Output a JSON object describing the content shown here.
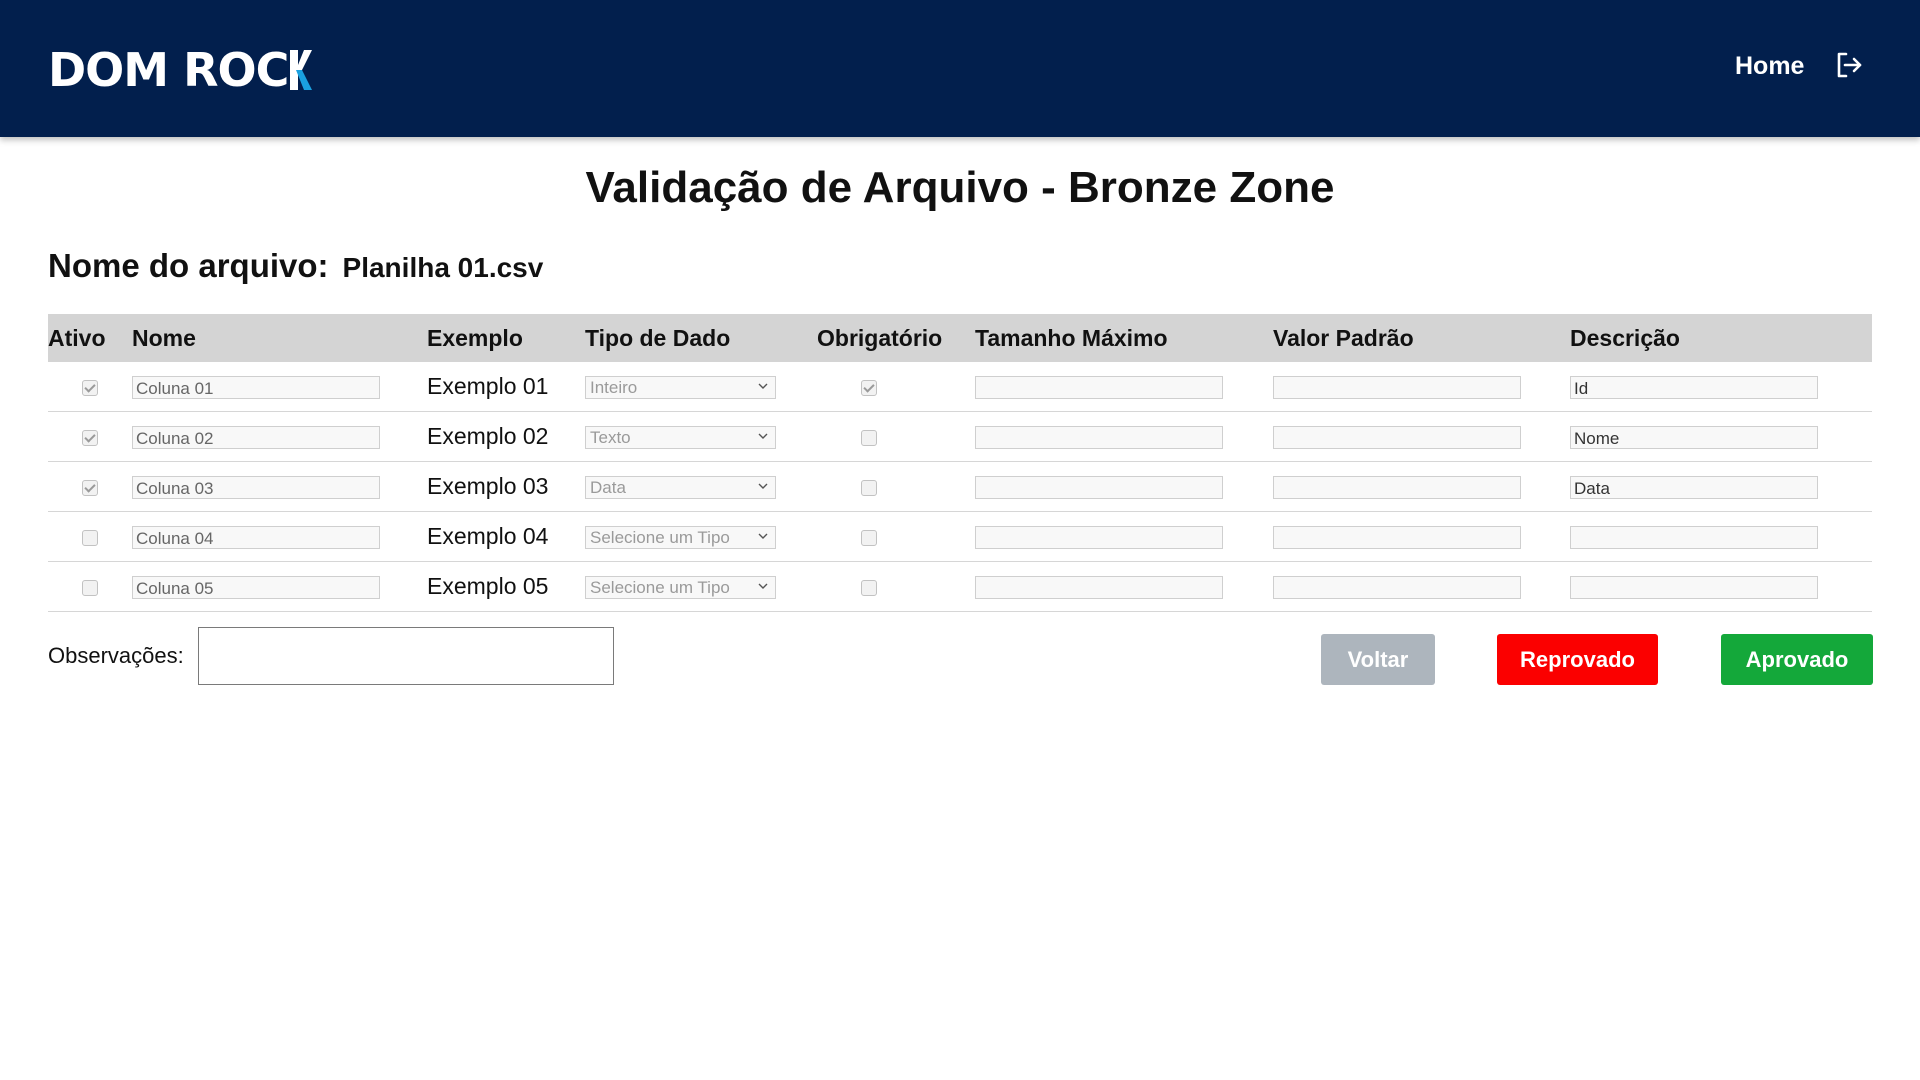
{
  "header": {
    "logo_text": "DOM ROC",
    "logo_accent": "#1aa1e0",
    "home_label": "Home",
    "logout_icon": "logout-icon",
    "bg_color": "#021f4d"
  },
  "page": {
    "title": "Validação de Arquivo - Bronze Zone",
    "file_label": "Nome do arquivo:",
    "file_name": "Planilha 01.csv"
  },
  "table": {
    "headers": {
      "ativo": "Ativo",
      "nome": "Nome",
      "exemplo": "Exemplo",
      "tipo": "Tipo de Dado",
      "obrigatorio": "Obrigatório",
      "tamanho": "Tamanho Máximo",
      "valor": "Valor Padrão",
      "descricao": "Descrição"
    },
    "rows": [
      {
        "ativo": true,
        "nome": "Coluna 01",
        "exemplo": "Exemplo 01",
        "tipo": "Inteiro",
        "obrigatorio": true,
        "tamanho": "",
        "valor": "",
        "descricao": "Id"
      },
      {
        "ativo": true,
        "nome": "Coluna 02",
        "exemplo": "Exemplo 02",
        "tipo": "Texto",
        "obrigatorio": false,
        "tamanho": "",
        "valor": "",
        "descricao": "Nome"
      },
      {
        "ativo": true,
        "nome": "Coluna 03",
        "exemplo": "Exemplo 03",
        "tipo": "Data",
        "obrigatorio": false,
        "tamanho": "",
        "valor": "",
        "descricao": "Data"
      },
      {
        "ativo": false,
        "nome": "Coluna 04",
        "exemplo": "Exemplo 04",
        "tipo": "Selecione um Tipo",
        "obrigatorio": false,
        "tamanho": "",
        "valor": "",
        "descricao": ""
      },
      {
        "ativo": false,
        "nome": "Coluna 05",
        "exemplo": "Exemplo 05",
        "tipo": "Selecione um Tipo",
        "obrigatorio": false,
        "tamanho": "",
        "valor": "",
        "descricao": ""
      }
    ]
  },
  "footer": {
    "obs_label": "Observações:",
    "obs_value": "",
    "voltar_label": "Voltar",
    "reprovado_label": "Reprovado",
    "aprovado_label": "Aprovado",
    "voltar_color": "#adb5bd",
    "reprovado_color": "#fb0000",
    "aprovado_color": "#14a83a"
  }
}
